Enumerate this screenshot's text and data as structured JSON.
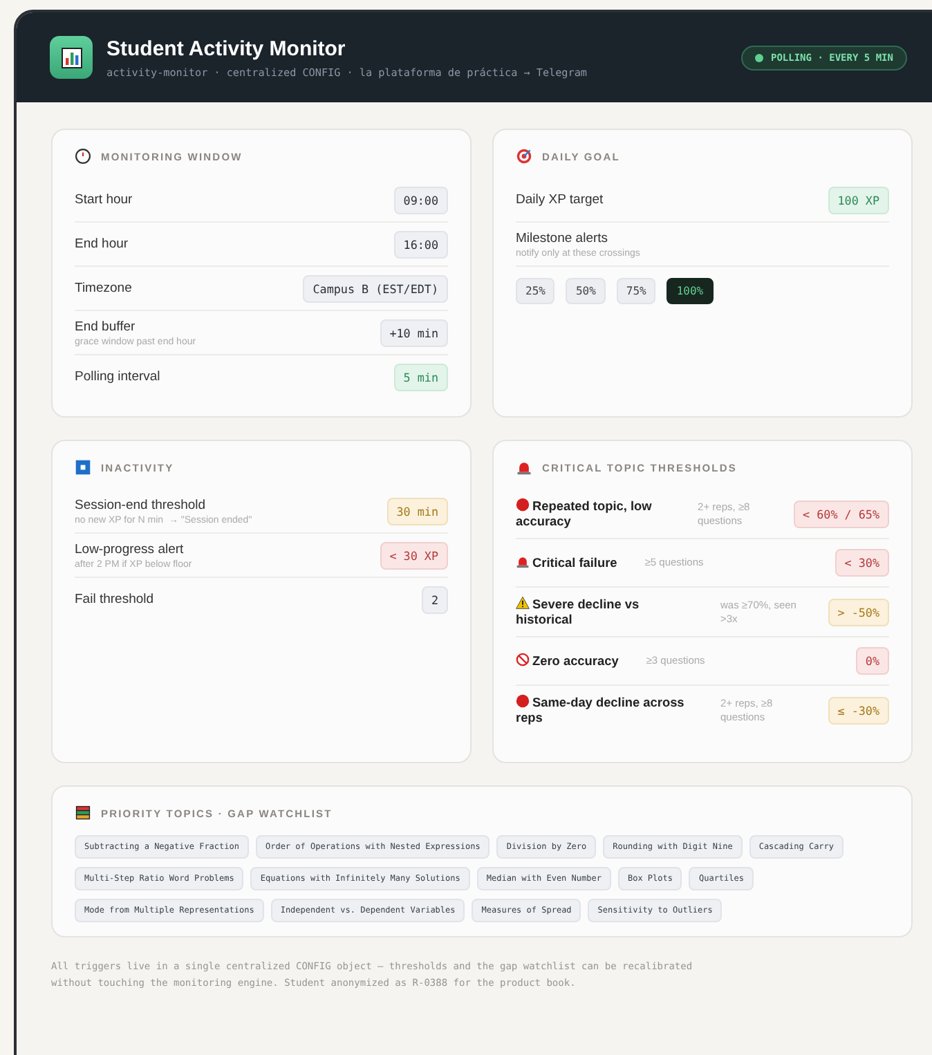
{
  "header": {
    "title": "Student Activity Monitor",
    "subtitle": "activity-monitor · centralized CONFIG · la plataforma de práctica → Telegram",
    "status": "POLLING · EVERY 5 MIN"
  },
  "monitoring_window": {
    "title": "MONITORING WINDOW",
    "rows": [
      {
        "label": "Start hour",
        "value": {
          "text": "09:00",
          "kind": "neutral"
        }
      },
      {
        "label": "End hour",
        "value": {
          "text": "16:00",
          "kind": "neutral"
        }
      },
      {
        "label": "Timezone",
        "value": {
          "text": "Campus B (EST/EDT)",
          "kind": "neutral"
        }
      },
      {
        "label": "End buffer",
        "hint": "grace window past end hour",
        "value": {
          "text": "+10 min",
          "kind": "neutral"
        }
      },
      {
        "label": "Polling interval",
        "value": {
          "text": "5 min",
          "kind": "positive"
        }
      }
    ]
  },
  "daily_goal": {
    "title": "DAILY GOAL",
    "target": {
      "label": "Daily XP target",
      "value": {
        "text": "100 XP",
        "kind": "positive"
      }
    },
    "milestones": {
      "label": "Milestone alerts",
      "hint": "notify only at these crossings",
      "options": [
        {
          "label": "25%",
          "selected": false
        },
        {
          "label": "50%",
          "selected": false
        },
        {
          "label": "75%",
          "selected": false
        },
        {
          "label": "100%",
          "selected": true
        }
      ]
    }
  },
  "inactivity": {
    "title": "INACTIVITY",
    "rows": [
      {
        "label": "Session-end threshold",
        "hint": "no new XP for N min  → \"Session ended\"",
        "value": {
          "text": "30 min",
          "kind": "warning"
        }
      },
      {
        "label": "Low-progress alert",
        "hint": "after 2 PM if XP below floor",
        "value": {
          "text": "< 30 XP",
          "kind": "negative"
        }
      },
      {
        "label": "Fail threshold",
        "value": {
          "text": "2",
          "kind": "neutral"
        }
      }
    ]
  },
  "critical_thresholds": {
    "title": "CRITICAL TOPIC THRESHOLDS",
    "rows": [
      {
        "kind": "dot",
        "label": "Repeated topic, low accuracy",
        "condition": "2+ reps, ≥8 questions",
        "value": {
          "text": "< 60% / 65%",
          "kind": "negative"
        }
      },
      {
        "kind": "siren",
        "label": "Critical failure",
        "condition": "≥5 questions",
        "value": {
          "text": "< 30%",
          "kind": "negative"
        }
      },
      {
        "kind": "warning",
        "label": "Severe decline vs historical",
        "condition": "was ≥70%, seen >3x",
        "value": {
          "text": "> -50%",
          "kind": "warning"
        }
      },
      {
        "kind": "blocked",
        "label": "Zero accuracy",
        "condition": "≥3 questions",
        "value": {
          "text": "0%",
          "kind": "negative"
        }
      },
      {
        "kind": "dot",
        "label": "Same-day decline across reps",
        "condition": "2+ reps, ≥8 questions",
        "value": {
          "text": "≤ -30%",
          "kind": "warning"
        }
      }
    ]
  },
  "priority_topics": {
    "title": "PRIORITY TOPICS · GAP WATCHLIST",
    "topics": [
      "Subtracting a Negative Fraction",
      "Order of Operations with Nested Expressions",
      "Division by Zero",
      "Rounding with Digit Nine",
      "Cascading Carry",
      "Multi-Step Ratio Word Problems",
      "Equations with Infinitely Many Solutions",
      "Median with Even Number",
      "Box Plots",
      "Quartiles",
      "Mode from Multiple Representations",
      "Independent vs. Dependent Variables",
      "Measures of Spread",
      "Sensitivity to Outliers"
    ]
  },
  "footer": "All triggers live in a single centralized CONFIG object — thresholds and the gap watchlist can be recalibrated without touching the monitoring engine. Student anonymized as R-0388 for the product book."
}
